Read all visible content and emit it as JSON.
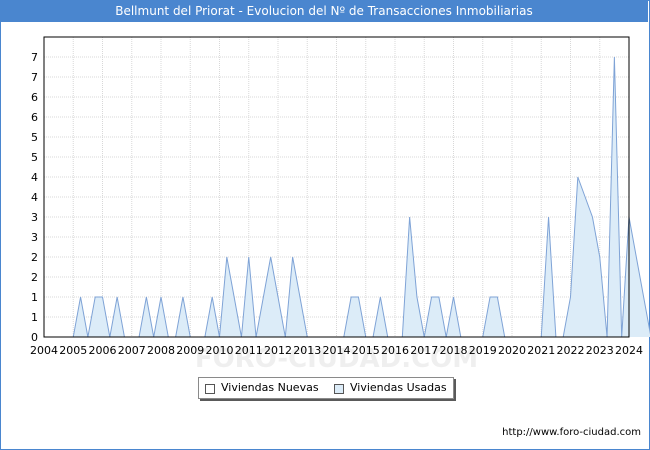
{
  "title": "Bellmunt del Priorat - Evolucion del Nº de Transacciones Inmobiliarias",
  "source": "http://www.foro-ciudad.com",
  "watermark": "FORO-CIUDAD.COM",
  "colors": {
    "header": "#4a86cf",
    "usadas_fill": "#dcecf8",
    "usadas_line": "#7fa3d6",
    "nuevas_fill": "#ffffff",
    "grid": "#d8d8d8"
  },
  "legend": {
    "nuevas": "Viviendas Nuevas",
    "usadas": "Viviendas Usadas"
  },
  "chart_data": {
    "type": "area",
    "x_tick_labels": [
      "2004",
      "2005",
      "2006",
      "2007",
      "2008",
      "2009",
      "2010",
      "2011",
      "2012",
      "2013",
      "2014",
      "2015",
      "2016",
      "2017",
      "2018",
      "2019",
      "2020",
      "2021",
      "2022",
      "2023",
      "2024"
    ],
    "y_tick_labels": [
      "0",
      "1",
      "1",
      "2",
      "2",
      "3",
      "3",
      "4",
      "4",
      "5",
      "5",
      "6",
      "6",
      "7",
      "7"
    ],
    "ylim": [
      0,
      7.5
    ],
    "grid": true,
    "legend_position": "bottom",
    "series": [
      {
        "name": "Viviendas Usadas",
        "x": [
          "2004 Q1",
          "2004 Q2",
          "2004 Q3",
          "2004 Q4",
          "2005 Q1",
          "2005 Q2",
          "2005 Q3",
          "2005 Q4",
          "2006 Q1",
          "2006 Q2",
          "2006 Q3",
          "2006 Q4",
          "2007 Q1",
          "2007 Q2",
          "2007 Q3",
          "2007 Q4",
          "2008 Q1",
          "2008 Q2",
          "2008 Q3",
          "2008 Q4",
          "2009 Q1",
          "2009 Q2",
          "2009 Q3",
          "2009 Q4",
          "2010 Q1",
          "2010 Q2",
          "2010 Q3",
          "2010 Q4",
          "2011 Q1",
          "2011 Q2",
          "2011 Q3",
          "2011 Q4",
          "2012 Q1",
          "2012 Q2",
          "2012 Q3",
          "2012 Q4",
          "2013 Q1",
          "2013 Q2",
          "2013 Q3",
          "2013 Q4",
          "2014 Q1",
          "2014 Q2",
          "2014 Q3",
          "2014 Q4",
          "2015 Q1",
          "2015 Q2",
          "2015 Q3",
          "2015 Q4",
          "2016 Q1",
          "2016 Q2",
          "2016 Q3",
          "2016 Q4",
          "2017 Q1",
          "2017 Q2",
          "2017 Q3",
          "2017 Q4",
          "2018 Q1",
          "2018 Q2",
          "2018 Q3",
          "2018 Q4",
          "2019 Q1",
          "2019 Q2",
          "2019 Q3",
          "2019 Q4",
          "2020 Q1",
          "2020 Q2",
          "2020 Q3",
          "2020 Q4",
          "2021 Q1",
          "2021 Q2",
          "2021 Q3",
          "2021 Q4",
          "2022 Q1",
          "2022 Q2",
          "2022 Q3",
          "2022 Q4",
          "2023 Q1",
          "2023 Q2",
          "2023 Q3",
          "2023 Q4",
          "2024 Q1",
          "2024 Q2",
          "2024 Q3",
          "2024 Q4"
        ],
        "values": [
          0,
          0,
          0,
          0,
          1,
          0,
          1,
          1,
          0,
          1,
          0,
          0,
          0,
          1,
          0,
          1,
          0,
          0,
          1,
          0,
          0,
          0,
          1,
          0,
          2,
          1,
          0,
          2,
          0,
          1,
          2,
          1,
          0,
          2,
          1,
          0,
          0,
          0,
          0,
          0,
          0,
          1,
          1,
          0,
          0,
          1,
          0,
          0,
          0,
          3,
          1,
          0,
          1,
          1,
          0,
          1,
          0,
          0,
          0,
          0,
          1,
          1,
          0,
          0,
          0,
          0,
          0,
          0,
          3,
          0,
          0,
          1,
          4,
          3.5,
          3,
          2,
          0,
          7,
          0,
          3,
          2,
          1,
          0,
          2
        ]
      },
      {
        "name": "Viviendas Nuevas",
        "x": [],
        "values": []
      }
    ]
  }
}
